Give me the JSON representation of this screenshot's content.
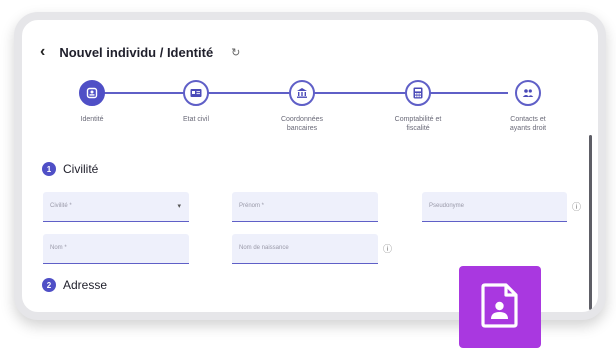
{
  "header": {
    "back_glyph": "‹",
    "title": "Nouvel individu / Identité",
    "refresh_glyph": "↻"
  },
  "stepper": {
    "steps": [
      {
        "label": "Identité",
        "icon": "id-card-icon",
        "active": true
      },
      {
        "label": "Etat civil",
        "icon": "card-icon",
        "active": false
      },
      {
        "label": "Coordonnées bancaires",
        "icon": "bank-icon",
        "active": false
      },
      {
        "label": "Comptabilité et fiscalité",
        "icon": "calculator-icon",
        "active": false
      },
      {
        "label": "Contacts et ayants droit",
        "icon": "people-icon",
        "active": false
      }
    ]
  },
  "sections": {
    "civilite": {
      "number": "1",
      "title": "Civilité"
    },
    "adresse": {
      "number": "2",
      "title": "Adresse"
    }
  },
  "fields": {
    "civilite": "Civilité *",
    "prenom": "Prénom *",
    "pseudonyme": "Pseudonyme",
    "nom": "Nom *",
    "nom_naissance": "Nom de naissance"
  },
  "colors": {
    "accent": "#4f4fc6",
    "field_bg": "#eef0fb",
    "badge": "#a938e0"
  }
}
